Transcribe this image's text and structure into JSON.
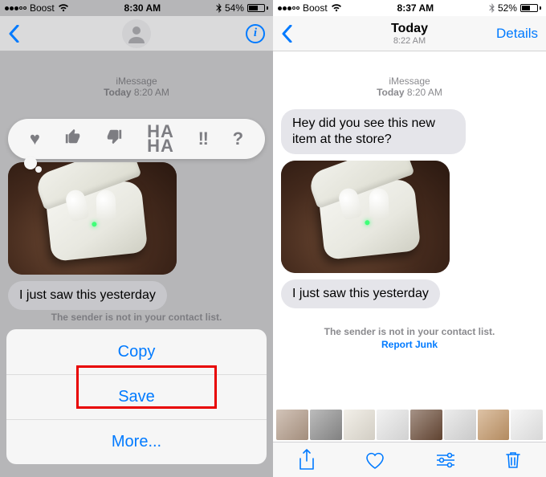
{
  "left": {
    "status": {
      "carrier": "Boost",
      "time": "8:30 AM",
      "battery_pct": "54%"
    },
    "nav": {
      "title": ""
    },
    "conv": {
      "service": "iMessage",
      "day": "Today",
      "time": "8:20 AM",
      "reply": "I just saw this yesterday",
      "warning": "The sender is not in your contact list."
    },
    "tapback": {
      "heart": "♥",
      "like": "👍",
      "dislike": "👎",
      "haha_top": "HA",
      "haha_bot": "HA",
      "exclaim": "‼",
      "question": "?"
    },
    "sheet": {
      "copy": "Copy",
      "save": "Save",
      "more": "More..."
    }
  },
  "right": {
    "status": {
      "carrier": "Boost",
      "time": "8:37 AM",
      "battery_pct": "52%"
    },
    "nav": {
      "title_day": "Today",
      "title_time": "8:22 AM",
      "details": "Details"
    },
    "conv": {
      "service": "iMessage",
      "day": "Today",
      "time": "8:20 AM",
      "msg1": "Hey did you see this new item at the store?",
      "reply": "I just saw this yesterday",
      "warning": "The sender is not in your contact list.",
      "report": "Report Junk"
    }
  }
}
